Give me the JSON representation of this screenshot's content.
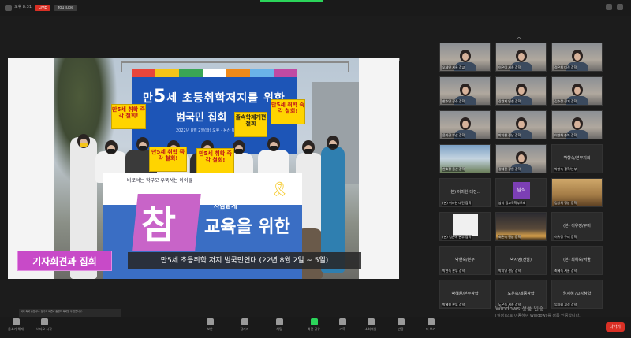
{
  "topbar": {
    "time_text": "오후 8:31",
    "live_label": "LIVE",
    "youtube_label": "YouTube"
  },
  "shared_screen": {
    "backdrop": {
      "title_prefix": "만",
      "title_big": "5",
      "title_rest": "세 초등취학저지를 위한",
      "subtitle": "범국민 집회",
      "small_text": "2022년 8월 2일(화) 오후 · 용산 대통령 집무실 앞"
    },
    "signs": [
      "만5세 취학 즉각 철회!",
      "만5세 취학 즉각 철회!",
      "만5세 취학 즉각 철회!",
      "졸속학제개편 철회",
      "만5세 취학 즉각 철회!"
    ],
    "banner": {
      "top_line": "바로서는 학부모 우뚝서는 아이들",
      "big_char": "참",
      "edu_line1": "사람답게",
      "edu_line2": "교육을 위한"
    },
    "caption_left": "기자회견과 집회",
    "caption_right": "만5세 초등취학 저지 범국민연대 (22년 8월 2일 ~ 5일)"
  },
  "gallery": {
    "tiles": [
      {
        "type": "video",
        "name": "오세연 서울 참교"
      },
      {
        "type": "video",
        "name": "이은이 세종 참학"
      },
      {
        "type": "video",
        "name": "정은희 대전 참학"
      },
      {
        "type": "video",
        "name": "한수영 광주 참학"
      },
      {
        "type": "video",
        "name": "장경지 인천 참학"
      },
      {
        "type": "video",
        "name": "김수정 경기 참학"
      },
      {
        "type": "video",
        "name": "윤미경 부산 참학"
      },
      {
        "type": "video",
        "name": "박지현 전남 참학"
      },
      {
        "type": "video",
        "name": "이영화 충북 참학"
      },
      {
        "type": "photo2",
        "name": "한효정 울산 참학"
      },
      {
        "type": "video",
        "name": "정혜진 강원 참학"
      },
      {
        "type": "name",
        "name": "박향숙/본부지회",
        "sub": "박향숙 참학/본부"
      },
      {
        "type": "name",
        "name": "(본) 이미현(대전...",
        "sub": "(본) 이미현 대전 참학"
      },
      {
        "type": "purple",
        "name": "남식",
        "sub": "남식 참교육학부모회"
      },
      {
        "type": "photo3",
        "name": "김양희 경남 참학"
      },
      {
        "type": "white-doc",
        "name": "(본) 김은해 본부 참학"
      },
      {
        "type": "sunset",
        "name": "최은숙(전남)",
        "sub": "최은숙 전남 참학"
      },
      {
        "type": "name",
        "name": "(본) 이유정/구미",
        "sub": "이유정 구미 참학"
      },
      {
        "type": "name",
        "name": "박현숙/본부",
        "sub": "박현숙 본부 참학"
      },
      {
        "type": "name",
        "name": "박지영(전남)",
        "sub": "박지영 전남 참학"
      },
      {
        "type": "name",
        "name": "(본) 최혜숙/서울",
        "sub": "최혜숙 서울 참학"
      },
      {
        "type": "name",
        "name": "박혜원/본부참학",
        "sub": "박혜원 본부 참학"
      },
      {
        "type": "name",
        "name": "도은숙/세종참학",
        "sub": "도은숙 세종 참학"
      },
      {
        "type": "name",
        "name": "임지혜 /고성참학",
        "sub": "임지혜 고성 참학"
      }
    ]
  },
  "watermark": {
    "line1": "Windows 정품 인증",
    "line2": "[설정]으로 이동하여 Windows를 정품 인증합니다."
  },
  "notice_text": "회의 녹화 중입니다. 참가자 화면과 음성이 녹화될 수 있습니다.",
  "toolbar": {
    "tools": [
      {
        "label": "음소거 해제",
        "icon": "mic-icon"
      },
      {
        "label": "비디오 시작",
        "icon": "video-icon"
      },
      {
        "label": "보안",
        "icon": "shield-icon"
      },
      {
        "label": "참가자",
        "icon": "participants-icon"
      },
      {
        "label": "채팅",
        "icon": "chat-icon"
      },
      {
        "label": "화면 공유",
        "icon": "share-screen-icon"
      },
      {
        "label": "기록",
        "icon": "record-icon"
      },
      {
        "label": "소회의실",
        "icon": "breakout-icon"
      },
      {
        "label": "반응",
        "icon": "reaction-icon"
      },
      {
        "label": "더 보기",
        "icon": "more-icon"
      }
    ],
    "leave_label": "나가기"
  }
}
